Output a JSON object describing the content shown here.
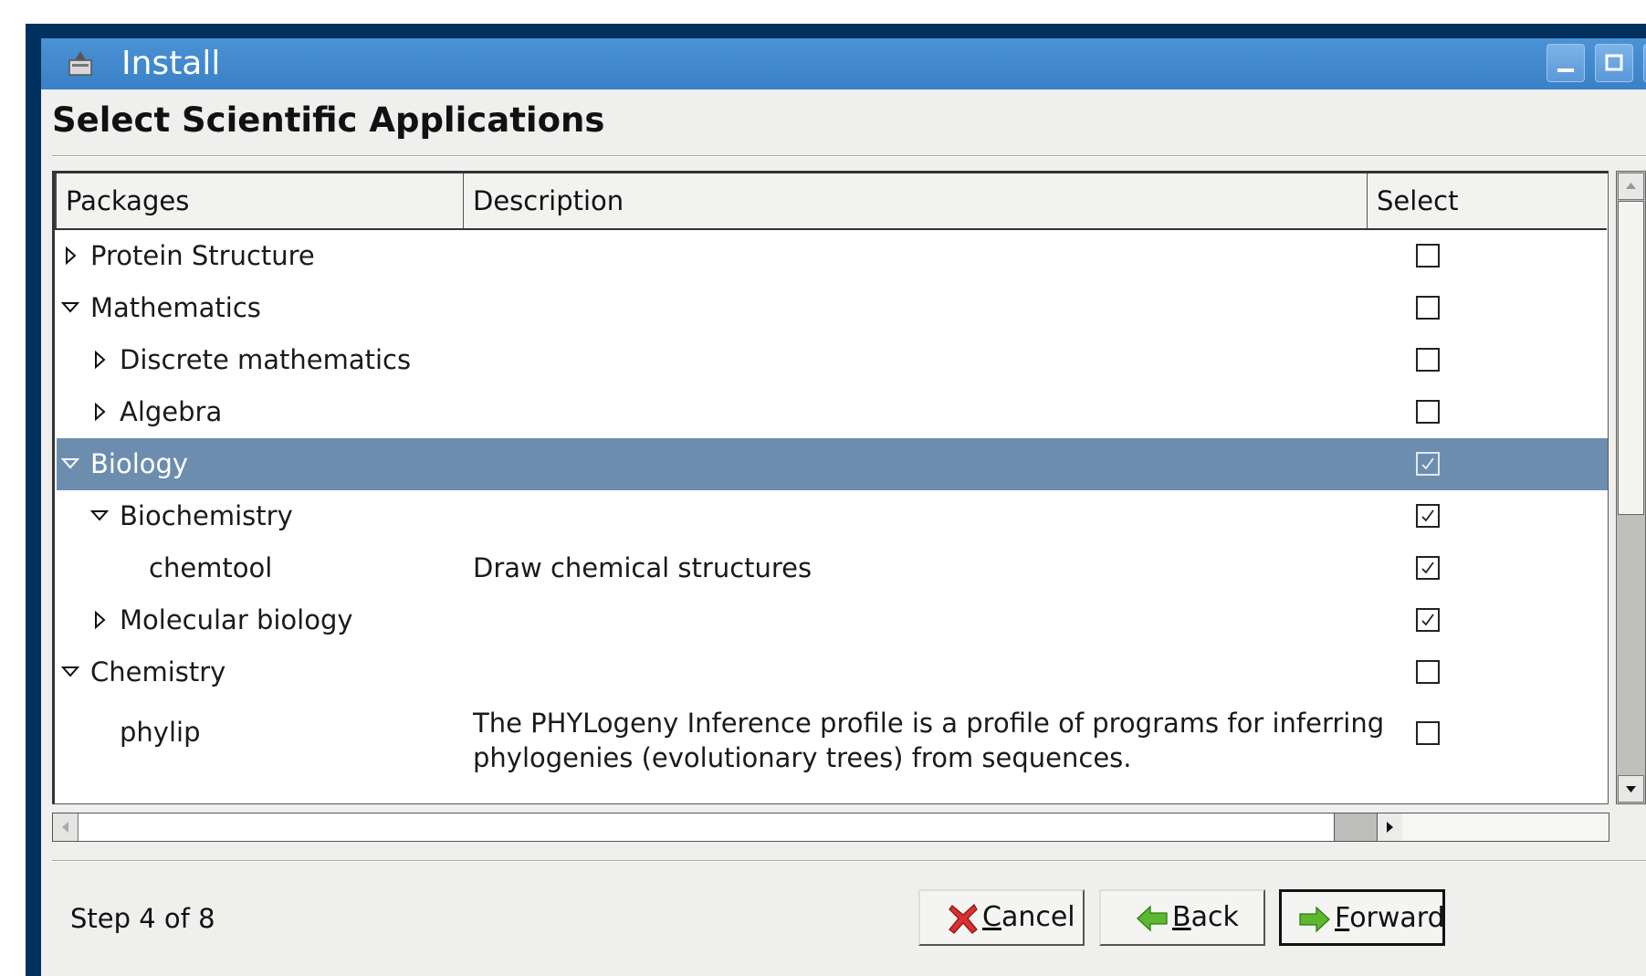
{
  "window": {
    "title": "Install",
    "controls": {
      "minimize": "minimize",
      "maximize": "maximize",
      "close": "close"
    }
  },
  "page": {
    "heading": "Select Scientific Applications"
  },
  "tree": {
    "columns": [
      "Packages",
      "Description",
      "Select"
    ],
    "rows": [
      {
        "label": "Protein Structure",
        "description": "",
        "expander": "collapsed",
        "checked": false
      },
      {
        "label": "Mathematics",
        "description": "",
        "expander": "expanded",
        "checked": false
      },
      {
        "label": "Discrete mathematics",
        "description": "",
        "expander": "collapsed",
        "checked": false
      },
      {
        "label": "Algebra",
        "description": "",
        "expander": "collapsed",
        "checked": false
      },
      {
        "label": "Biology",
        "description": "",
        "expander": "expanded",
        "checked": true,
        "selected": true
      },
      {
        "label": "Biochemistry",
        "description": "",
        "expander": "expanded",
        "checked": true
      },
      {
        "label": "chemtool",
        "description": "Draw chemical structures",
        "expander": "none",
        "checked": true
      },
      {
        "label": "Molecular biology",
        "description": "",
        "expander": "collapsed",
        "checked": true
      },
      {
        "label": "Chemistry",
        "description": "",
        "expander": "expanded",
        "checked": false
      },
      {
        "label": "phylip",
        "description": "The PHYLogeny Inference profile is a profile of programs for inferring",
        "description_line2": "phylogenies (evolutionary trees) from sequences.",
        "expander": "none",
        "checked": false
      }
    ]
  },
  "footer": {
    "step": "Step 4 of 8",
    "cancel_label": "Cancel",
    "back_label": "Back",
    "forward_label": "Forward"
  },
  "colors": {
    "titlebar": "#3a80c6",
    "selection": "#6d8daf",
    "background": "#efefed"
  },
  "icons": {
    "app": "install-icon",
    "cancel": "red-x-icon",
    "back": "green-left-arrow-icon",
    "forward": "green-right-arrow-icon"
  }
}
